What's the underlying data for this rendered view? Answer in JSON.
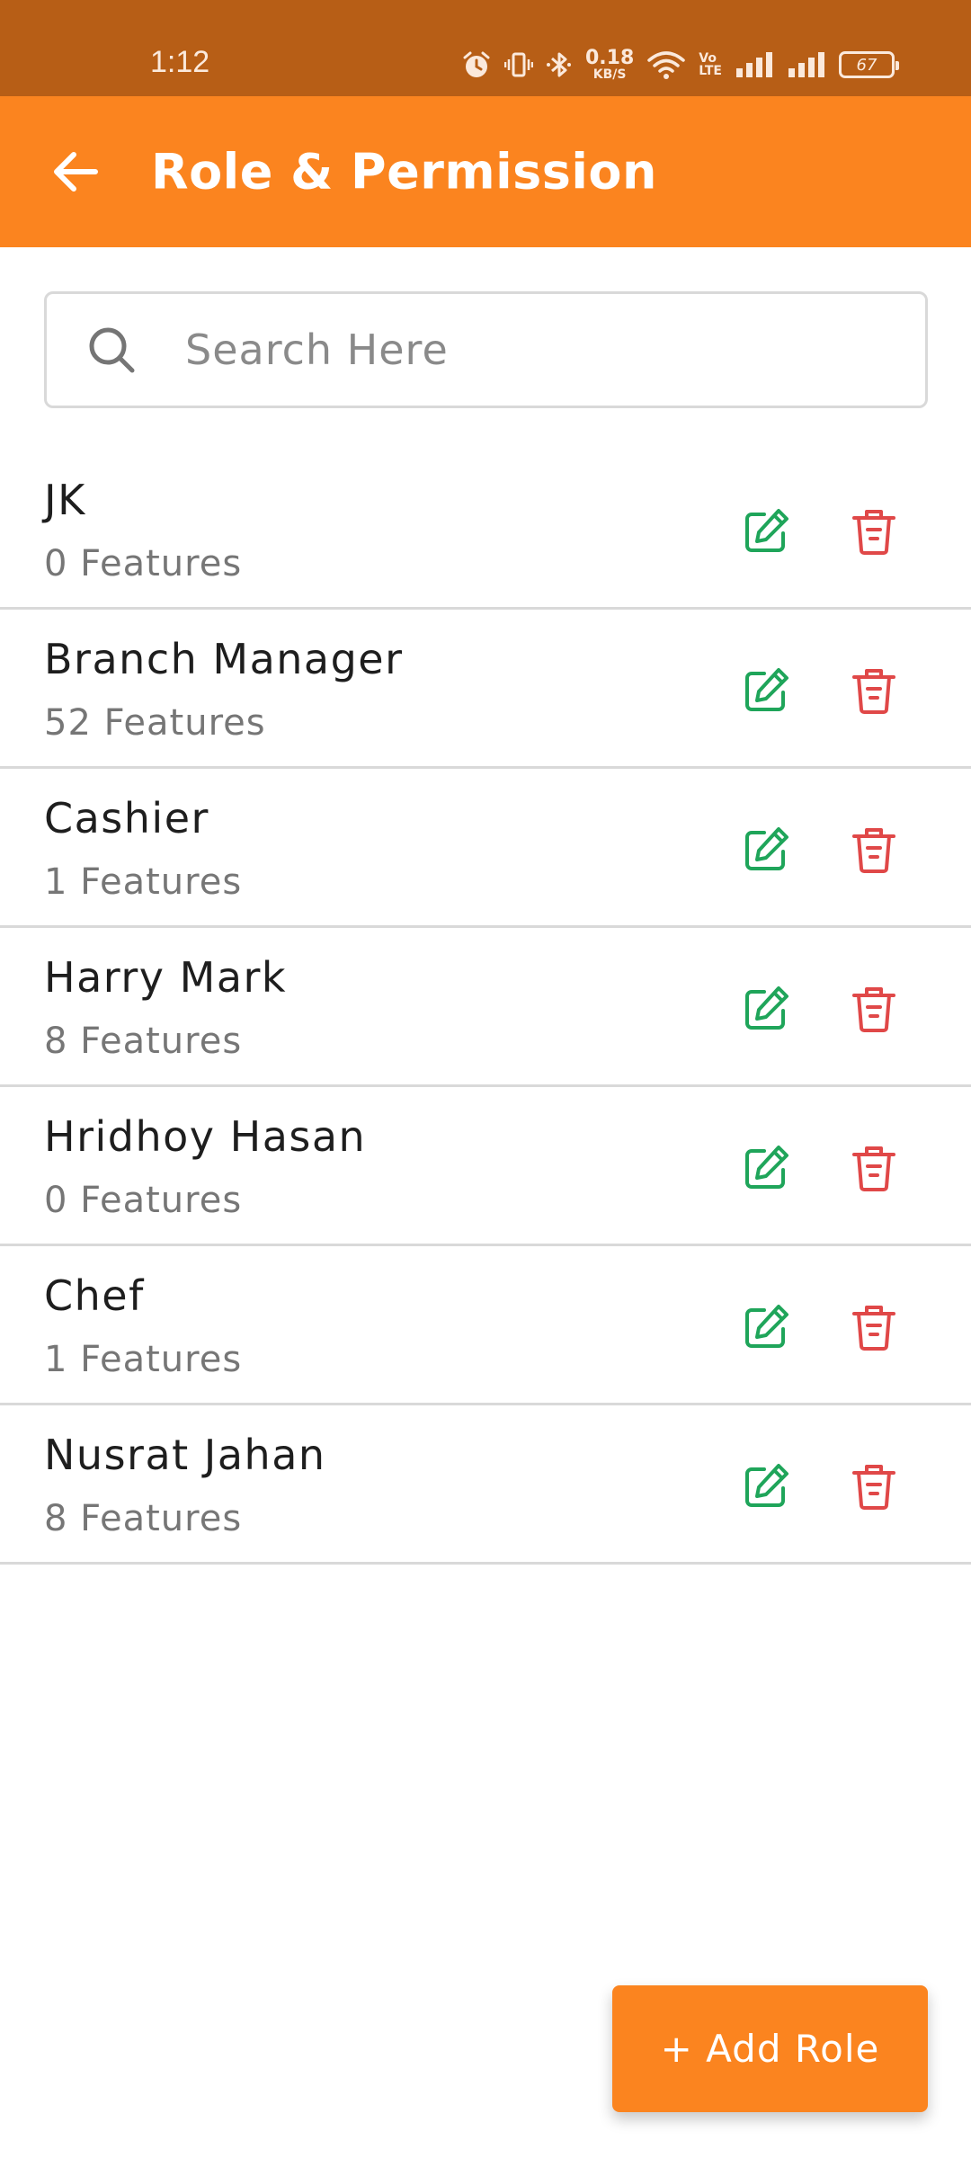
{
  "status_bar": {
    "time": "1:12",
    "net_speed_value": "0.18",
    "net_speed_unit": "KB/S",
    "volte_top": "Vo",
    "volte_bottom": "LTE",
    "battery": "67",
    "icons": [
      "alarm-icon",
      "vibrate-icon",
      "bluetooth-icon",
      "wifi-icon",
      "signal-icon",
      "signal-icon",
      "battery-icon"
    ]
  },
  "header": {
    "title": "Role & Permission",
    "back_icon": "arrow-left-icon"
  },
  "search": {
    "placeholder": "Search Here",
    "value": ""
  },
  "roles": [
    {
      "name": "JK",
      "features": "0 Features"
    },
    {
      "name": "Branch Manager",
      "features": "52 Features"
    },
    {
      "name": "Cashier",
      "features": "1 Features"
    },
    {
      "name": "Harry Mark",
      "features": "8 Features"
    },
    {
      "name": "Hridhoy Hasan",
      "features": "0 Features"
    },
    {
      "name": "Chef",
      "features": "1 Features"
    },
    {
      "name": "Nusrat Jahan",
      "features": "8 Features"
    }
  ],
  "add_button": {
    "label": "+ Add Role"
  },
  "colors": {
    "status_bar": "#b75e16",
    "primary": "#fb841f",
    "edit": "#1fa55a",
    "delete": "#e04848",
    "divider": "#d9d9d9"
  }
}
